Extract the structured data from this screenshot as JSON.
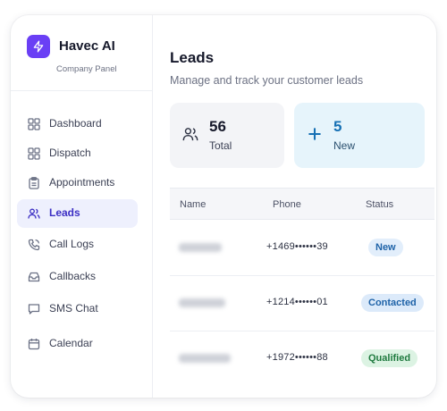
{
  "brand": {
    "name": "Havec AI",
    "subtitle": "Company Panel",
    "logo_icon": "lightning-icon",
    "accent": "#6a3ff5"
  },
  "sidebar": {
    "items": [
      {
        "label": "Dashboard",
        "icon": "grid-icon",
        "active": false
      },
      {
        "label": "Dispatch",
        "icon": "grid-icon",
        "active": false
      },
      {
        "label": "Appointments",
        "icon": "clipboard-icon",
        "active": false
      },
      {
        "label": "Leads",
        "icon": "users-icon",
        "active": true
      },
      {
        "label": "Call Logs",
        "icon": "phone-icon",
        "active": false
      },
      {
        "label": "Callbacks",
        "icon": "inbox-icon",
        "active": false
      },
      {
        "label": "SMS Chat",
        "icon": "chat-icon",
        "active": false
      },
      {
        "label": "Calendar",
        "icon": "calendar-icon",
        "active": false
      }
    ]
  },
  "main": {
    "title": "Leads",
    "subtitle": "Manage and track your customer leads",
    "stats": [
      {
        "value": "56",
        "label": "Total",
        "icon": "users-icon"
      },
      {
        "value": "5",
        "label": "New",
        "icon": "plus-icon"
      }
    ],
    "table": {
      "columns": [
        "Name",
        "Phone",
        "Status"
      ],
      "rows": [
        {
          "phone": "+1469••••••39",
          "status": "New",
          "status_color": "#1f63a8",
          "status_bg": "#e2eefb"
        },
        {
          "phone": "+1214••••••01",
          "status": "Contacted",
          "status_color": "#1f63a8",
          "status_bg": "#dceafa"
        },
        {
          "phone": "+1972••••••88",
          "status": "Qualified",
          "status_color": "#1f7a3f",
          "status_bg": "#dcf3e3"
        }
      ]
    }
  }
}
